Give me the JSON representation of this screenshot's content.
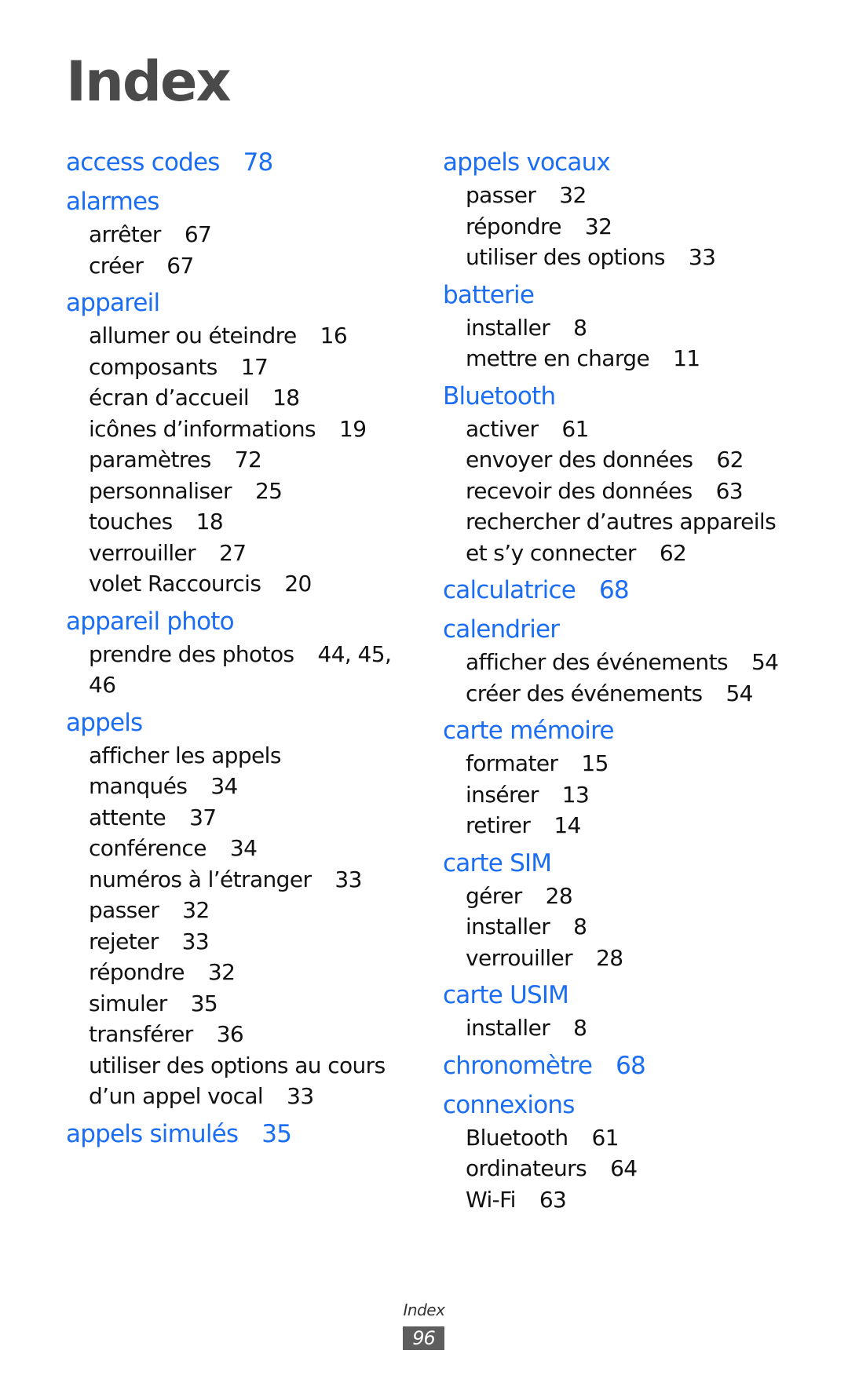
{
  "page": {
    "title": "Index",
    "footer_label": "Index",
    "page_number": "96",
    "colors": {
      "heading": "#1b6ef3",
      "title": "#4a4a4a",
      "text": "#111111",
      "page_box": "#5e5e5e"
    }
  },
  "left_column": [
    {
      "term": "access codes",
      "pages": "78",
      "subentries": []
    },
    {
      "term": "alarmes",
      "pages": "",
      "subentries": [
        {
          "text": "arrêter",
          "pages": "67"
        },
        {
          "text": "créer",
          "pages": "67"
        }
      ]
    },
    {
      "term": "appareil",
      "pages": "",
      "subentries": [
        {
          "text": "allumer ou éteindre",
          "pages": "16"
        },
        {
          "text": "composants",
          "pages": "17"
        },
        {
          "text": "écran d’accueil",
          "pages": "18"
        },
        {
          "text": "icônes d’informations",
          "pages": "19"
        },
        {
          "text": "paramètres",
          "pages": "72"
        },
        {
          "text": "personnaliser",
          "pages": "25"
        },
        {
          "text": "touches",
          "pages": "18"
        },
        {
          "text": "verrouiller",
          "pages": "27"
        },
        {
          "text": "volet Raccourcis",
          "pages": "20"
        }
      ]
    },
    {
      "term": "appareil photo",
      "pages": "",
      "subentries": [
        {
          "text": "prendre des photos",
          "pages": "44, 45, 46"
        }
      ]
    },
    {
      "term": "appels",
      "pages": "",
      "subentries": [
        {
          "text": "afficher les appels manqués",
          "pages": "34"
        },
        {
          "text": "attente",
          "pages": "37"
        },
        {
          "text": "conférence",
          "pages": "34"
        },
        {
          "text": "numéros à l’étranger",
          "pages": "33"
        },
        {
          "text": "passer",
          "pages": "32"
        },
        {
          "text": "rejeter",
          "pages": "33"
        },
        {
          "text": "répondre",
          "pages": "32"
        },
        {
          "text": "simuler",
          "pages": "35"
        },
        {
          "text": "transférer",
          "pages": "36"
        },
        {
          "text": "utiliser des options au cours d’un appel vocal",
          "pages": "33"
        }
      ]
    },
    {
      "term": "appels simulés",
      "pages": "35",
      "subentries": []
    }
  ],
  "right_column": [
    {
      "term": "appels vocaux",
      "pages": "",
      "subentries": [
        {
          "text": "passer",
          "pages": "32"
        },
        {
          "text": "répondre",
          "pages": "32"
        },
        {
          "text": "utiliser des options",
          "pages": "33"
        }
      ]
    },
    {
      "term": "batterie",
      "pages": "",
      "subentries": [
        {
          "text": "installer",
          "pages": "8"
        },
        {
          "text": "mettre en charge",
          "pages": "11"
        }
      ]
    },
    {
      "term": "Bluetooth",
      "pages": "",
      "subentries": [
        {
          "text": "activer",
          "pages": "61"
        },
        {
          "text": "envoyer des données",
          "pages": "62"
        },
        {
          "text": "recevoir des données",
          "pages": "63"
        },
        {
          "text": "rechercher d’autres appareils et s’y connecter",
          "pages": "62"
        }
      ]
    },
    {
      "term": "calculatrice",
      "pages": "68",
      "subentries": []
    },
    {
      "term": "calendrier",
      "pages": "",
      "subentries": [
        {
          "text": "afficher des événements",
          "pages": "54"
        },
        {
          "text": "créer des événements",
          "pages": "54"
        }
      ]
    },
    {
      "term": "carte mémoire",
      "pages": "",
      "subentries": [
        {
          "text": "formater",
          "pages": "15"
        },
        {
          "text": "insérer",
          "pages": "13"
        },
        {
          "text": "retirer",
          "pages": "14"
        }
      ]
    },
    {
      "term": "carte SIM",
      "pages": "",
      "subentries": [
        {
          "text": "gérer",
          "pages": "28"
        },
        {
          "text": "installer",
          "pages": "8"
        },
        {
          "text": "verrouiller",
          "pages": "28"
        }
      ]
    },
    {
      "term": "carte USIM",
      "pages": "",
      "subentries": [
        {
          "text": "installer",
          "pages": "8"
        }
      ]
    },
    {
      "term": "chronomètre",
      "pages": "68",
      "subentries": []
    },
    {
      "term": "connexions",
      "pages": "",
      "subentries": [
        {
          "text": "Bluetooth",
          "pages": "61"
        },
        {
          "text": "ordinateurs",
          "pages": "64"
        },
        {
          "text": "Wi-Fi",
          "pages": "63"
        }
      ]
    }
  ]
}
